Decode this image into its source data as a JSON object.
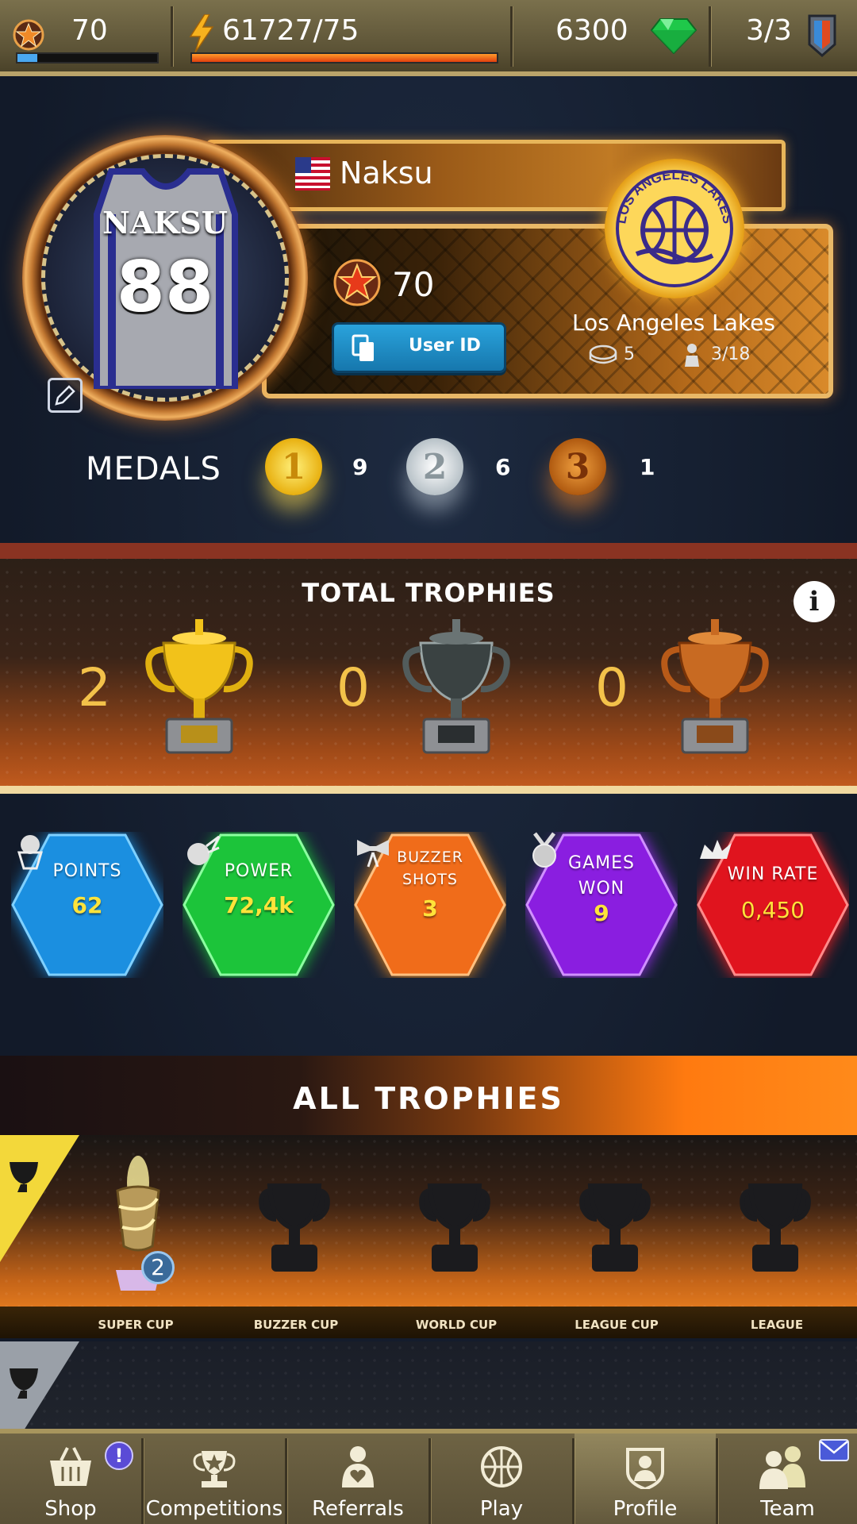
{
  "topbar": {
    "level": "70",
    "level_progress": 0.14,
    "energy": "61727/75",
    "energy_progress": 1.0,
    "gems": "6300",
    "tickets": "3/3"
  },
  "profile": {
    "player_name": "Naksu",
    "jersey_name": "NAKSU",
    "jersey_number": "88",
    "level": "70",
    "user_id_label": "User ID",
    "team_name": "Los Angeles Lakes",
    "team_logo_text": "LOS ANGELES LAKES",
    "stadium_count": "5",
    "coach_count": "3/18"
  },
  "medals": {
    "label": "MEDALS",
    "gold_label": "1",
    "gold_count": "9",
    "silver_label": "2",
    "silver_count": "6",
    "bronze_label": "3",
    "bronze_count": "1"
  },
  "total_trophies": {
    "title": "TOTAL TROPHIES",
    "gold": "2",
    "silver": "0",
    "bronze": "0"
  },
  "stats": [
    {
      "label": "POINTS",
      "value": "62",
      "color": "#1b8fe0"
    },
    {
      "label": "POWER",
      "value": "72,4k",
      "color": "#1cc43a"
    },
    {
      "label": "BUZZER SHOTS",
      "value": "3",
      "color": "#f06c1a"
    },
    {
      "label": "GAMES WON",
      "value": "9",
      "color": "#8a1ee0"
    },
    {
      "label": "WIN RATE",
      "value": "0,450",
      "color": "#e0141e"
    }
  ],
  "all_trophies": {
    "title": "ALL TROPHIES",
    "super_cup_count": "2",
    "cups": [
      "SUPER CUP",
      "BUZZER CUP",
      "WORLD CUP",
      "LEAGUE CUP",
      "LEAGUE"
    ]
  },
  "nav": [
    {
      "label": "Shop",
      "badge": "!"
    },
    {
      "label": "Competitions"
    },
    {
      "label": "Referrals"
    },
    {
      "label": "Play"
    },
    {
      "label": "Profile",
      "active": true
    },
    {
      "label": "Team"
    }
  ]
}
